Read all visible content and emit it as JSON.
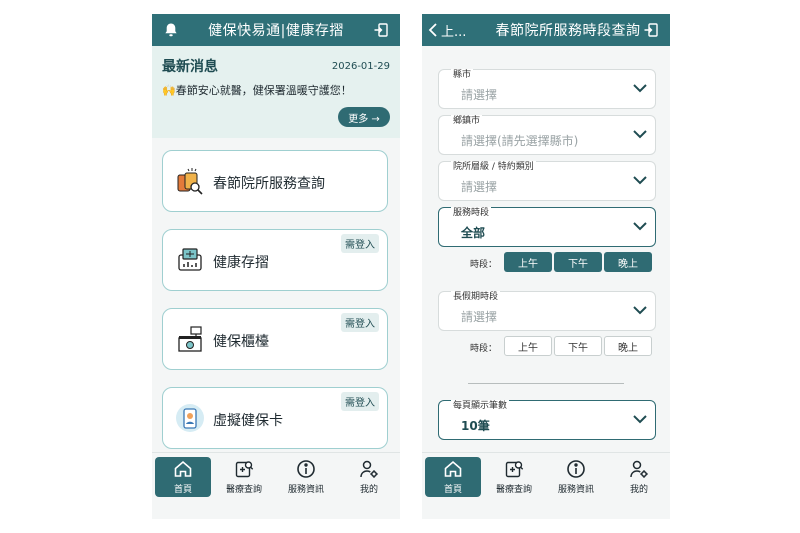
{
  "left": {
    "header": {
      "title": "健保快易通|健康存摺"
    },
    "news": {
      "title": "最新消息",
      "date": "2026-01-29",
      "text": "🙌春節安心就醫，健保署溫暖守護您！",
      "more_label": "更多 →"
    },
    "cards": [
      {
        "label": "春節院所服務查詢",
        "badge": ""
      },
      {
        "label": "健康存摺",
        "badge": "需登入"
      },
      {
        "label": "健保櫃檯",
        "badge": "需登入"
      },
      {
        "label": "虛擬健保卡",
        "badge": "需登入"
      }
    ]
  },
  "right": {
    "header": {
      "back_label": "上...",
      "title": "春節院所服務時段查詢"
    },
    "fields": {
      "county": {
        "label": "縣市",
        "value": "請選擇"
      },
      "township": {
        "label": "鄉鎮市",
        "value": "請選擇(請先選擇縣市)"
      },
      "level": {
        "label": "院所層級 / 特約類別",
        "value": "請選擇"
      },
      "service_period": {
        "label": "服務時段",
        "value": "全部"
      },
      "holiday_period": {
        "label": "長假期時段",
        "value": "請選擇"
      },
      "page_size": {
        "label": "每頁顯示筆數",
        "value": "10筆"
      }
    },
    "time_label": "時段：",
    "service_slots": [
      {
        "label": "上午",
        "selected": true
      },
      {
        "label": "下午",
        "selected": true
      },
      {
        "label": "晚上",
        "selected": true
      }
    ],
    "holiday_slots": [
      {
        "label": "上午",
        "selected": false
      },
      {
        "label": "下午",
        "selected": false
      },
      {
        "label": "晚上",
        "selected": false
      }
    ]
  },
  "tabbar": {
    "items": [
      {
        "label": "首頁",
        "icon": "home-icon",
        "active": true
      },
      {
        "label": "醫療查詢",
        "icon": "medical-search-icon",
        "active": false
      },
      {
        "label": "服務資訊",
        "icon": "info-icon",
        "active": false
      },
      {
        "label": "我的",
        "icon": "user-settings-icon",
        "active": false
      }
    ]
  },
  "colors": {
    "primary": "#2f7078",
    "news_bg": "#e5f1ef",
    "card_border": "#9fcfd0"
  }
}
